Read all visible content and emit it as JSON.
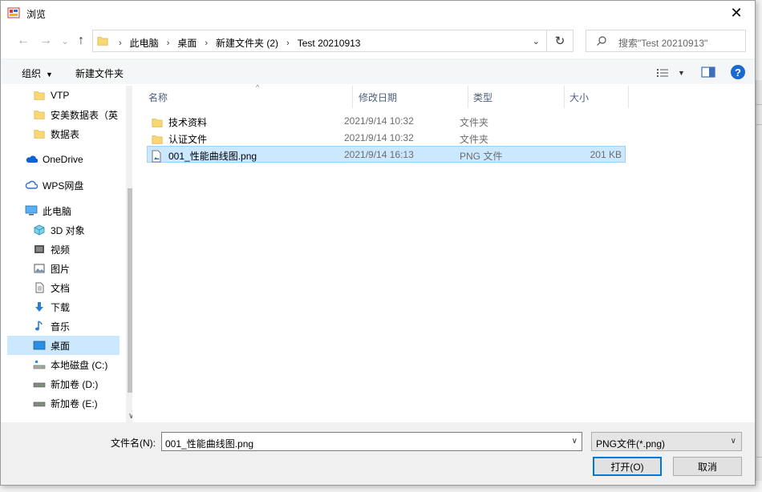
{
  "window": {
    "title": "浏览",
    "close_glyph": "✕"
  },
  "nav": {
    "back_glyph": "←",
    "forward_glyph": "→",
    "recent_glyph": "⌄",
    "up_glyph": "↑",
    "breadcrumbs": [
      "此电脑",
      "桌面",
      "新建文件夹 (2)",
      "Test 20210913"
    ],
    "search_placeholder": "搜索\"Test 20210913\"",
    "refresh_glyph": "↻",
    "search_glyph": "⚲"
  },
  "toolbar": {
    "organize_label": "组织",
    "new_folder_label": "新建文件夹",
    "help_label": "?"
  },
  "navpane": {
    "items": [
      {
        "label": "VTP",
        "icon": "folder-icon"
      },
      {
        "label": "安美数据表（英",
        "icon": "folder-icon"
      },
      {
        "label": "数据表",
        "icon": "folder-icon"
      },
      {
        "label": "OneDrive",
        "icon": "onedrive-icon"
      },
      {
        "label": "WPS网盘",
        "icon": "cloud-icon"
      },
      {
        "label": "此电脑",
        "icon": "computer-icon"
      },
      {
        "label": "3D 对象",
        "icon": "cube-icon"
      },
      {
        "label": "视频",
        "icon": "video-icon"
      },
      {
        "label": "图片",
        "icon": "picture-icon"
      },
      {
        "label": "文档",
        "icon": "document-icon"
      },
      {
        "label": "下载",
        "icon": "download-icon"
      },
      {
        "label": "音乐",
        "icon": "music-icon"
      },
      {
        "label": "桌面",
        "icon": "desktop-icon"
      },
      {
        "label": "本地磁盘 (C:)",
        "icon": "drive-icon"
      },
      {
        "label": "新加卷 (D:)",
        "icon": "drive-icon"
      },
      {
        "label": "新加卷 (E:)",
        "icon": "drive-icon"
      }
    ]
  },
  "filelist": {
    "columns": {
      "name": "名称",
      "date": "修改日期",
      "type": "类型",
      "size": "大小"
    },
    "rows": [
      {
        "name": "技术资料",
        "date": "2021/9/14 10:32",
        "type": "文件夹",
        "size": "",
        "icon": "folder-icon"
      },
      {
        "name": "认证文件",
        "date": "2021/9/14 10:32",
        "type": "文件夹",
        "size": "",
        "icon": "folder-icon"
      },
      {
        "name": "001_性能曲线图.png",
        "date": "2021/9/14 16:13",
        "type": "PNG 文件",
        "size": "201 KB",
        "icon": "image-file-icon"
      }
    ]
  },
  "bottom": {
    "filename_label": "文件名(N):",
    "filename_value": "001_性能曲线图.png",
    "filter_value": "PNG文件(*.png)",
    "open_label": "打开(O)",
    "cancel_label": "取消"
  },
  "colors": {
    "selection": "#cce8ff",
    "selection_border": "#99d1ff",
    "accent": "#0078d7",
    "folder": "#f8d775"
  }
}
